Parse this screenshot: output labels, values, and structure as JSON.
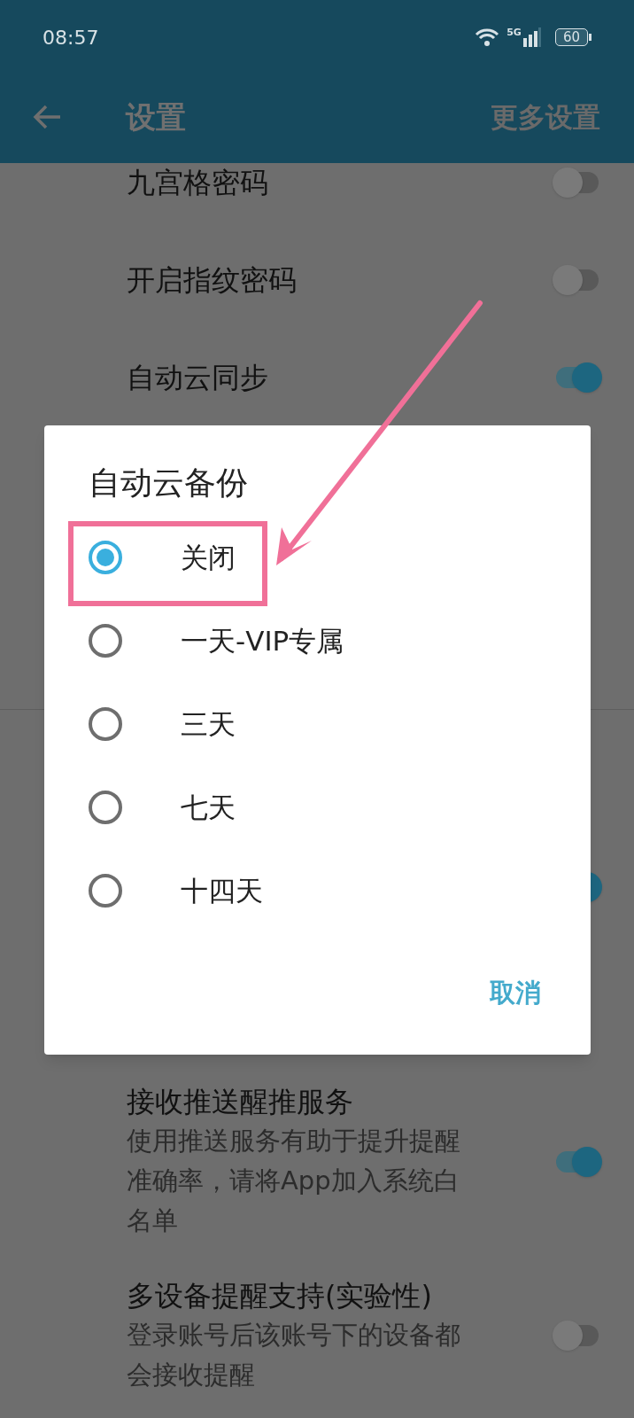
{
  "status_bar": {
    "time": "08:57",
    "network": "5G",
    "battery": "60"
  },
  "app_bar": {
    "title": "设置",
    "action": "更多设置"
  },
  "settings": [
    {
      "kind": "toggle",
      "label": "九宫格密码",
      "on": false
    },
    {
      "kind": "toggle",
      "label": "开启指纹密码",
      "on": false
    },
    {
      "kind": "toggle",
      "label": "自动云同步",
      "on": true
    },
    {
      "kind": "divider"
    },
    {
      "kind": "toggle_only",
      "on": true
    },
    {
      "kind": "toggle",
      "label": "接收推送醒推服务",
      "description": "使用推送服务有助于提升提醒准确率，请将App加入系统白名单",
      "on": true
    },
    {
      "kind": "toggle",
      "label": "多设备提醒支持(实验性)",
      "description": "登录账号后该账号下的设备都会接收提醒",
      "on": false
    }
  ],
  "dialog": {
    "title": "自动云备份",
    "options": [
      {
        "label": "关闭",
        "selected": true
      },
      {
        "label": "一天-VIP专属",
        "selected": false
      },
      {
        "label": "三天",
        "selected": false
      },
      {
        "label": "七天",
        "selected": false
      },
      {
        "label": "十四天",
        "selected": false
      }
    ],
    "cancel": "取消"
  }
}
